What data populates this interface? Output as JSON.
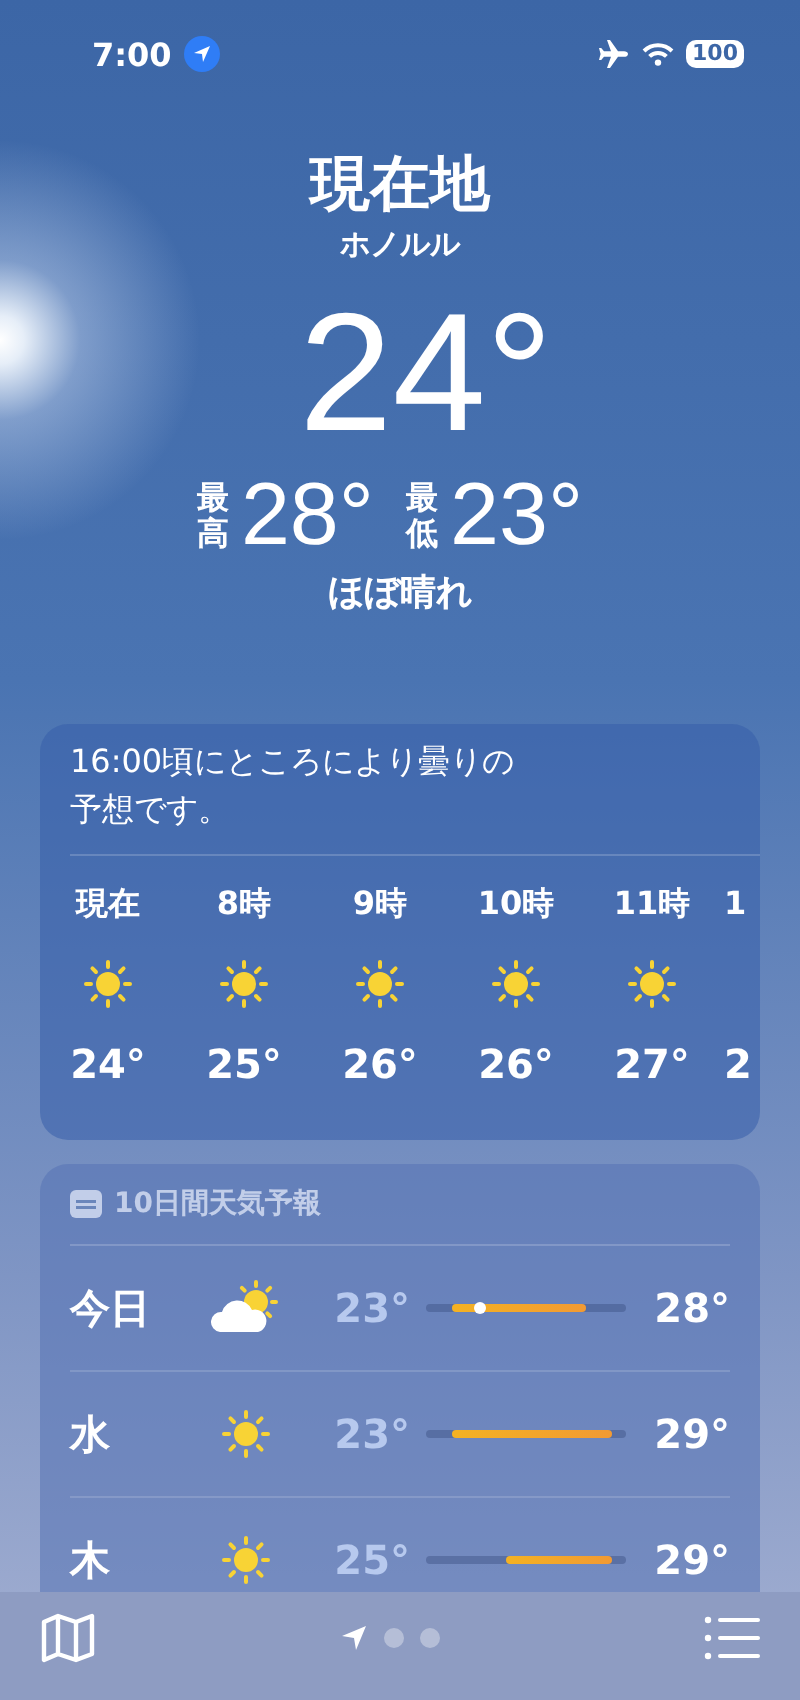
{
  "status_bar": {
    "time": "7:00",
    "location_active": true,
    "airplane_mode": true,
    "battery": "100"
  },
  "header": {
    "title": "現在地",
    "city": "ホノルル",
    "temperature": "24°",
    "high_label": "最高",
    "high": "28°",
    "low_label": "最低",
    "low": "23°",
    "condition": "ほぼ晴れ"
  },
  "hourly": {
    "summary": "16:00頃にところにより曇りの予想です。",
    "hours": [
      {
        "label": "現在",
        "kind": "sunny",
        "temp": "24°"
      },
      {
        "label": "8時",
        "kind": "sunny",
        "temp": "25°"
      },
      {
        "label": "9時",
        "kind": "sunny",
        "temp": "26°"
      },
      {
        "label": "10時",
        "kind": "sunny",
        "temp": "26°"
      },
      {
        "label": "11時",
        "kind": "sunny",
        "temp": "27°"
      },
      {
        "label": "1",
        "kind": "cut",
        "temp": "2"
      }
    ]
  },
  "daily": {
    "title": "10日間天気予報",
    "days": [
      {
        "day": "今日",
        "kind": "partly_cloudy",
        "low": "23°",
        "high": "28°",
        "current_marker": true
      },
      {
        "day": "水",
        "kind": "sunny",
        "low": "23°",
        "high": "29°",
        "current_marker": false
      },
      {
        "day": "木",
        "kind": "sunny",
        "low": "25°",
        "high": "29°",
        "current_marker": false
      }
    ]
  },
  "tab_bar": {
    "pages": [
      {
        "kind": "location",
        "selected": true
      },
      {
        "kind": "dot",
        "selected": false
      },
      {
        "kind": "dot",
        "selected": false
      }
    ]
  }
}
